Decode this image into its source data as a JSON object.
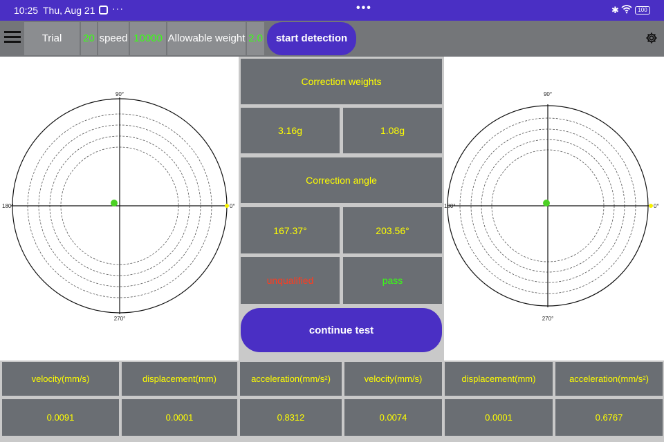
{
  "status_bar": {
    "time": "10:25",
    "date": "Thu, Aug 21",
    "more": "···",
    "center_dots": "•••",
    "battery": "100"
  },
  "toolbar": {
    "trial_weight_label": "Trial weight:",
    "trial_weight_value": "20",
    "speed_label": "speed",
    "speed_value": "10000",
    "allowable_label": "Allowable weight",
    "allowable_value": "2.0",
    "start_label": "start detection"
  },
  "polar_left": {
    "label_90": "90°",
    "label_180": "180°",
    "label_270": "270°",
    "label_0": "0°"
  },
  "polar_right": {
    "label_90": "90°",
    "label_180": "180°",
    "label_270": "270°",
    "label_0": "0°"
  },
  "center": {
    "correction_weights_label": "Correction weights",
    "weight_left": "3.16g",
    "weight_right": "1.08g",
    "correction_angle_label": "Correction angle",
    "angle_left": "167.37°",
    "angle_right": "203.56°",
    "status_left": "unqualified",
    "status_right": "pass",
    "continue_label": "continue test"
  },
  "table": {
    "headers": [
      "velocity(mm/s)",
      "displacement(mm)",
      "acceleration(mm/s²)",
      "velocity(mm/s)",
      "displacement(mm)",
      "acceleration(mm/s²)"
    ],
    "values": [
      "0.0091",
      "0.0001",
      "0.8312",
      "0.0074",
      "0.0001",
      "0.6767"
    ]
  },
  "colors": {
    "accent": "#4a2fc4",
    "value_green": "#39ff14",
    "cell_text_yellow": "#ffff00",
    "fail_red": "#ff3b1f",
    "cell_bg": "#6a6e73"
  },
  "icons": [
    "menu-icon",
    "gear-icon",
    "bluetooth-icon",
    "wifi-icon",
    "battery-icon"
  ]
}
